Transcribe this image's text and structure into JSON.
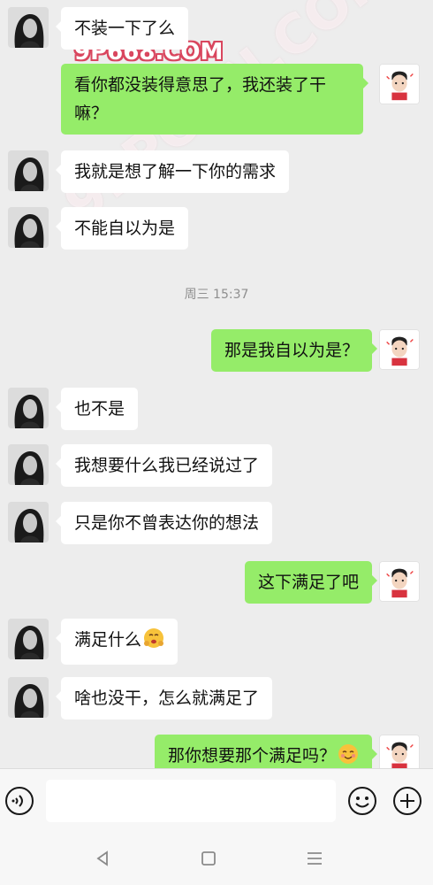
{
  "watermarks": {
    "site_small": "9P668.COM",
    "site_large": "91PORN.COM"
  },
  "messages": [
    {
      "side": "in",
      "text": "不装一下了么"
    },
    {
      "side": "out",
      "text": "看你都没装得意思了，我还装了干嘛？"
    },
    {
      "side": "in",
      "text": "我就是想了解一下你的需求"
    },
    {
      "side": "in",
      "text": "不能自以为是"
    },
    {
      "side": "out",
      "text": "那是我自以为是？"
    },
    {
      "side": "in",
      "text": "也不是"
    },
    {
      "side": "in",
      "text": "我想要什么我已经说过了"
    },
    {
      "side": "in",
      "text": "只是你不曾表达你的想法"
    },
    {
      "side": "out",
      "text": "这下满足了吧"
    },
    {
      "side": "in",
      "text": "满足什么",
      "emoji": "hugging-face-emoji"
    },
    {
      "side": "in",
      "text": "啥也没干，怎么就满足了"
    },
    {
      "side": "out",
      "text": "那你想要那个满足吗？",
      "emoji": "blushing-face-emoji"
    }
  ],
  "timestamp": "周三 15:37",
  "input": {
    "value": "",
    "placeholder": ""
  },
  "icons": {
    "voice": "voice-icon",
    "emoji": "smiley-icon",
    "plus": "plus-icon",
    "back": "back-triangle-icon",
    "home": "home-square-icon",
    "menu": "menu-lines-icon"
  },
  "colors": {
    "sent_bubble": "#95ec69",
    "received_bubble": "#ffffff",
    "background": "#ededed"
  }
}
